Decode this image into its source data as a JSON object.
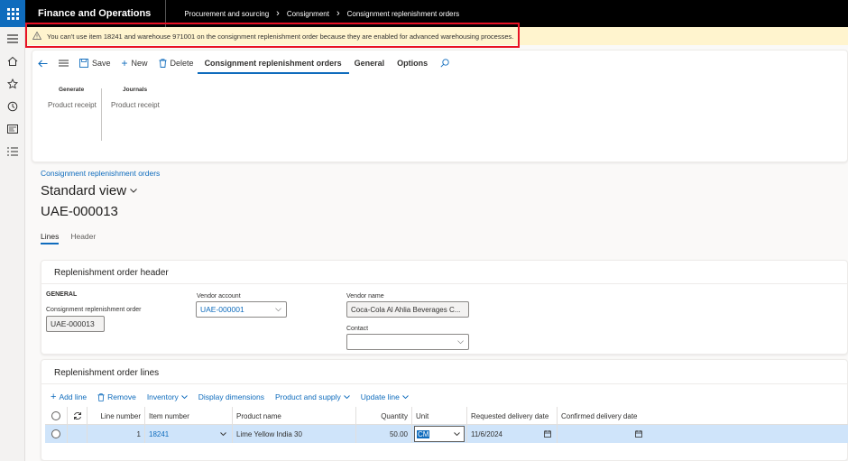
{
  "topbar": {
    "app_title": "Finance and Operations",
    "breadcrumbs": [
      "Procurement and sourcing",
      "Consignment",
      "Consignment replenishment orders"
    ]
  },
  "message": {
    "text": "You can't use item 18241 and warehouse 971001 on the consignment replenishment order because they are enabled for advanced warehousing processes."
  },
  "action_pane": {
    "save": "Save",
    "new": "New",
    "delete": "Delete",
    "tabs": [
      "Consignment replenishment orders",
      "General",
      "Options"
    ],
    "groups": [
      {
        "title": "Generate",
        "item": "Product receipt"
      },
      {
        "title": "Journals",
        "item": "Product receipt"
      }
    ]
  },
  "page": {
    "breadcrumb": "Consignment replenishment orders",
    "view_name": "Standard view",
    "record_id": "UAE-000013",
    "tabs": [
      "Lines",
      "Header"
    ]
  },
  "header_card": {
    "title": "Replenishment order header",
    "section": "GENERAL",
    "order_label": "Consignment replenishment order",
    "order_value": "UAE-000013",
    "vendor_account_label": "Vendor account",
    "vendor_account_value": "UAE-000001",
    "vendor_name_label": "Vendor name",
    "vendor_name_value": "Coca-Cola Al Ahlia Beverages C...",
    "contact_label": "Contact",
    "contact_value": ""
  },
  "lines_card": {
    "title": "Replenishment order lines",
    "toolbar": {
      "add_line": "Add line",
      "remove": "Remove",
      "inventory": "Inventory",
      "display_dimensions": "Display dimensions",
      "product_and_supply": "Product and supply",
      "update_line": "Update line"
    },
    "columns": {
      "line_number": "Line number",
      "item_number": "Item number",
      "product_name": "Product name",
      "quantity": "Quantity",
      "unit": "Unit",
      "requested_delivery_date": "Requested delivery date",
      "confirmed_delivery_date": "Confirmed delivery date"
    },
    "rows": [
      {
        "line_number": "1",
        "item_number": "18241",
        "product_name": "Lime Yellow India 30",
        "quantity": "50.00",
        "unit": "CM",
        "requested_delivery_date": "11/6/2024",
        "confirmed_delivery_date": ""
      }
    ]
  },
  "colors": {
    "accent": "#0f6cbd",
    "topbar": "#000000",
    "warning_bg": "#fff4ce",
    "highlight_border": "#e81123",
    "selected_row": "#cfe4fa"
  }
}
